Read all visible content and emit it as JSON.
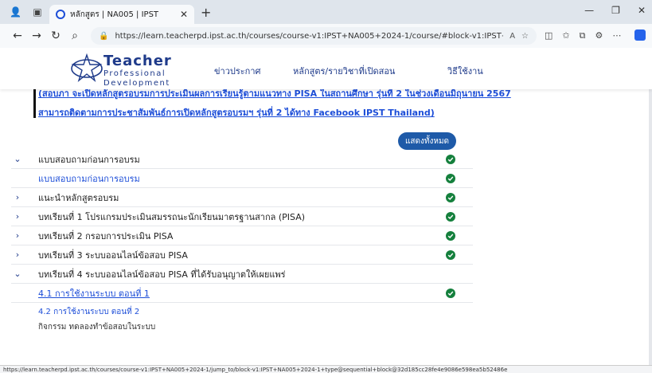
{
  "browser": {
    "tab_title": "หลักสูตร | NA005 | IPST",
    "url": "https://learn.teacherpd.ipst.ac.th/courses/course-v1:IPST+NA005+2024-1/course/#block-v1:IPST+NA005+2024-1+type@se...",
    "status_url": "https://learn.teacherpd.ipst.ac.th/courses/course-v1:IPST+NA005+2024-1/jump_to/block-v1:IPST+NA005+2024-1+type@sequential+block@32d185cc28fe4e9086e598ea5b52486e"
  },
  "header": {
    "logo_big": "Teacher",
    "logo_line2": "Professional",
    "logo_line3": "Development",
    "nav": [
      "ข่าวประกาศ",
      "หลักสูตร/รายวิชาที่เปิดสอน",
      "วิธีใช้งาน"
    ]
  },
  "banner": {
    "line1": "(สอบภา จะเปิดหลักสูตรอบรมการประเมินผลการเรียนรู้ตามแนวทาง PISA ในสถานศึกษา รุ่นที่ 2 ในช่วงเดือนมิถุนายน 2567",
    "line2": "สามารถติดตามการประชาสัมพันธ์การเปิดหลักสูตรอบรมฯ รุ่นที่ 2 ได้ทาง Facebook IPST Thailand)"
  },
  "show_all_label": "แสดงทั้งหมด",
  "sections": [
    {
      "label": "แบบสอบถามก่อนการอบรม",
      "expanded": true
    },
    {
      "label": "แบบสอบถามก่อนการอบรม",
      "sub": true
    },
    {
      "label": "แนะนำหลักสูตรอบรม"
    },
    {
      "label": "บทเรียนที่ 1 โปรแกรมประเมินสมรรถนะนักเรียนมาตรฐานสากล (PISA)"
    },
    {
      "label": "บทเรียนที่ 2 กรอบการประเมิน PISA"
    },
    {
      "label": "บทเรียนที่ 3 ระบบออนไลน์ข้อสอบ PISA"
    },
    {
      "label": "บทเรียนที่ 4 ระบบออนไลน์ข้อสอบ PISA ที่ได้รับอนุญาตให้เผยแพร่",
      "expanded": true
    },
    {
      "label": "4.1 การใช้งานระบบ ตอนที่ 1"
    }
  ],
  "item_42": {
    "title": "4.2 การใช้งานระบบ ตอนที่ 2",
    "sub": "กิจกรรม ทดลองทำข้อสอบในระบบ"
  },
  "colors": {
    "accent": "#1e5aa8",
    "check": "#15803d",
    "link": "#1d4ed8"
  }
}
